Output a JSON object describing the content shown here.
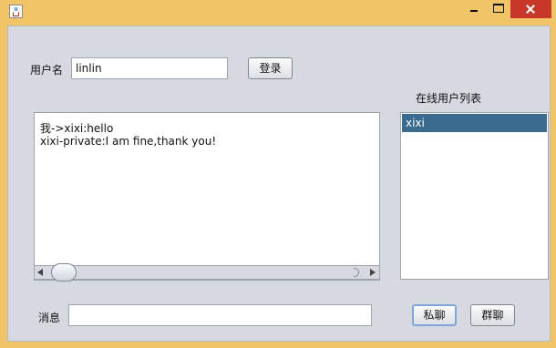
{
  "window": {
    "icon": "java-cup-icon"
  },
  "login": {
    "username_label": "用户名",
    "username_value": "linlin",
    "login_button": "登录"
  },
  "online_users": {
    "title": "在线用户列表",
    "items": [
      "xixi"
    ]
  },
  "chat": {
    "messages": [
      "我->xixi:hello",
      "xixi-private:I am fine,thank you!"
    ]
  },
  "compose": {
    "message_label": "消息",
    "message_value": "",
    "private_button": "私聊",
    "group_button": "群聊"
  },
  "colors": {
    "title_bar": "#f2c468",
    "close_button": "#c7382b",
    "panel": "#d6d9df",
    "list_selection": "#3a6b8e"
  }
}
